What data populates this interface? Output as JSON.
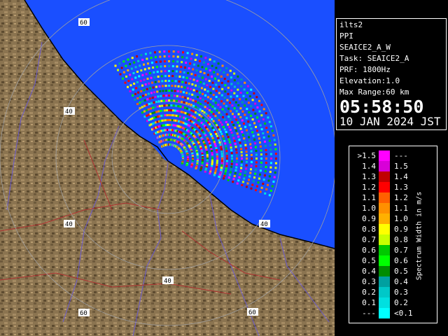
{
  "info": {
    "radar_name": "ilts2",
    "scan_type": "PPI",
    "scan_name": "SEAICE2_A_W",
    "task": "Task: SEAICE2_A",
    "prf": "PRF: 1800Hz",
    "elevation": "Elevation:1.0",
    "max_range": "Max Range:60 km",
    "time": "05:58:50",
    "date": "10 JAN 2024 JST"
  },
  "legend": {
    "unit_label": "Spectrum Width in m/s",
    "rows": [
      {
        "left": ">1.5",
        "right": "---",
        "color": "#ff00ff"
      },
      {
        "left": "1.4",
        "right": "1.5",
        "color": "#d800d8"
      },
      {
        "left": "1.3",
        "right": "1.4",
        "color": "#c00000"
      },
      {
        "left": "1.2",
        "right": "1.3",
        "color": "#ff0000"
      },
      {
        "left": "1.1",
        "right": "1.2",
        "color": "#ff6000"
      },
      {
        "left": "1.0",
        "right": "1.1",
        "color": "#ff9000"
      },
      {
        "left": "0.9",
        "right": "1.0",
        "color": "#ffb000"
      },
      {
        "left": "0.8",
        "right": "0.9",
        "color": "#ffff00"
      },
      {
        "left": "0.7",
        "right": "0.8",
        "color": "#c8ff00"
      },
      {
        "left": "0.6",
        "right": "0.7",
        "color": "#00c800"
      },
      {
        "left": "0.5",
        "right": "0.6",
        "color": "#00ff00"
      },
      {
        "left": "0.4",
        "right": "0.5",
        "color": "#008c00"
      },
      {
        "left": "0.3",
        "right": "0.4",
        "color": "#00a0a0"
      },
      {
        "left": "0.2",
        "right": "0.3",
        "color": "#00c8c8"
      },
      {
        "left": "0.1",
        "right": "0.2",
        "color": "#00e0e0"
      },
      {
        "left": "---",
        "right": "<0.1",
        "color": "#00ffff"
      }
    ]
  },
  "range_ring_labels": [
    "60",
    "60",
    "40",
    "40",
    "40",
    "40",
    "60"
  ],
  "colors": {
    "sea": "#1a4fff",
    "land": "#8b7450",
    "coast": "#000000",
    "ring": "#a0a0a0",
    "river": "#6a5acd",
    "road": "#b03030"
  }
}
